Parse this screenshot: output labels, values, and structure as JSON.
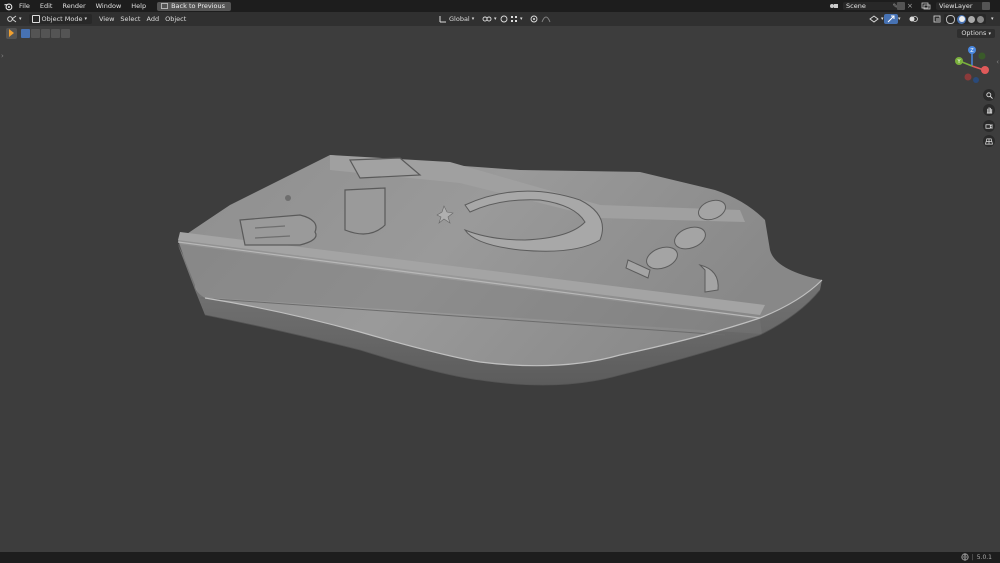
{
  "topbar": {
    "menu": [
      "File",
      "Edit",
      "Render",
      "Window",
      "Help"
    ],
    "back_button": "Back to Previous",
    "scene_label": "Scene",
    "view_layer_label": "ViewLayer"
  },
  "header": {
    "editor_type_icon": "viewport-icon",
    "mode": "Object Mode",
    "menu": [
      "View",
      "Select",
      "Add",
      "Object"
    ],
    "transform_orientation": "Global"
  },
  "toolbar": {
    "options_label": "Options"
  },
  "statusbar": {
    "version": "5.0.1"
  },
  "colors": {
    "axis_x": "#e05a5a",
    "axis_y": "#7ab03c",
    "axis_z": "#4a88e0",
    "viewport_bg": "#3d3d3d"
  }
}
